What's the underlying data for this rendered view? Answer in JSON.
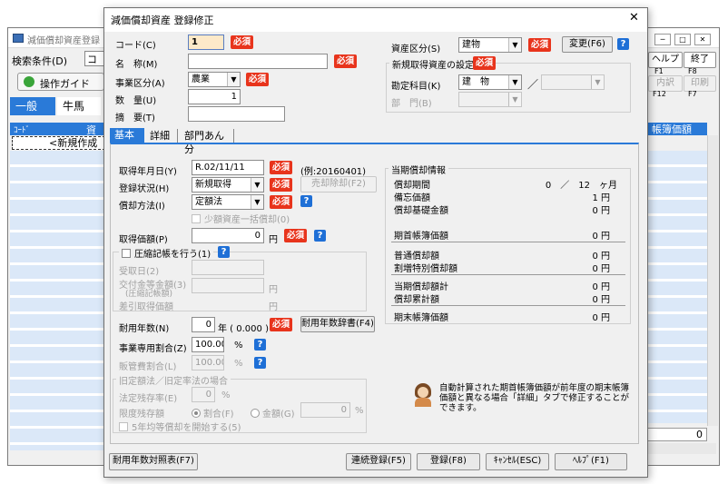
{
  "bg": {
    "title": "減価償却資産登録",
    "search_label": "検索条件(D)",
    "search_cut": "コ",
    "guide_btn": "操作ガイド",
    "tab_general": "一般",
    "tab_horse": "牛馬",
    "col_code": "ｺｰﾄﾞ",
    "col_asset": "資",
    "col_book": "帳簿価額",
    "new_row": "<新規作成",
    "help_btn": "ヘルプ",
    "end_btn": "終了",
    "f1": "F1",
    "f8": "F8",
    "detail_btn": "内訳",
    "print_btn": "印刷",
    "f12": "F12",
    "f7": "F7",
    "total": "0"
  },
  "dlg": {
    "title": "減価償却資産 登録修正",
    "close": "✕",
    "required": "必須",
    "code_label": "コード(C)",
    "code_value": "1",
    "name_label": "名　称(M)",
    "name_value": "",
    "biz_label": "事業区分(A)",
    "biz_value": "農業",
    "qty_label": "数　量(U)",
    "qty_value": "1",
    "memo_label": "摘　要(T)",
    "asset_cat_label": "資産区分(S)",
    "asset_cat_value": "建物",
    "change_btn": "変更(F6)",
    "new_setting_title": "新規取得資産の設定",
    "account_label": "勘定科目(K)",
    "account_value": "建　物",
    "slash": "／",
    "dept_label": "部　門(B)"
  },
  "tabs": [
    "基本",
    "詳細",
    "部門あん分"
  ],
  "basic": {
    "acq_date_label": "取得年月日(Y)",
    "acq_date_value": "R.02/11/11",
    "acq_date_example": "(例:20160401)",
    "reg_status_label": "登録状況(H)",
    "reg_status_value": "新規取得",
    "sale_btn": "売却除却(F2)",
    "method_label": "償却方法(I)",
    "method_value": "定額法",
    "small_asset": "少額資産一括償却(0)",
    "acq_price_label": "取得価額(P)",
    "acq_price_value": "0",
    "yen": "円",
    "compress_title": "圧縮記帳を行う(1)",
    "received_date": "受取日(2)",
    "subsidy_label1": "交付金等金額(3)",
    "subsidy_label2": "(圧縮記帳額)",
    "deduct_price": "差引取得価額",
    "life_label": "耐用年数(N)",
    "life_value": "0",
    "life_unit": "年 ( 0.000 )",
    "life_dict_btn": "耐用年数辞書(F4)",
    "biz_ratio_label": "事業専用割合(Z)",
    "biz_ratio_value": "100.00",
    "sell_ratio_label": "販管費割合(L)",
    "sell_ratio_value": "100.00",
    "percent": "%",
    "old_method_title": "旧定額法／旧定率法の場合",
    "residual_rate_label": "法定残存率(E)",
    "residual_rate_value": "0",
    "limit_label": "限度残存額",
    "ratio_radio": "割合(F)",
    "amount_radio": "金額(G)",
    "limit_amount_value": "0",
    "five_year": "5年均等償却を開始する(5)"
  },
  "period": {
    "title": "当期償却情報",
    "dep_period_label": "償却期間",
    "dep_period_value": "0　／　12　ヶ月",
    "memo_value_label": "備忘価額",
    "memo_value": "1 円",
    "base_label": "償却基礎金額",
    "base_value": "0 円",
    "opening_label": "期首帳簿価額",
    "opening_value": "0 円",
    "normal_label": "普通償却額",
    "normal_value": "0 円",
    "special_label": "割増特別償却額",
    "special_value": "0 円",
    "current_label": "当期償却額計",
    "current_value": "0 円",
    "cumulative_label": "償却累計額",
    "cumulative_value": "0 円",
    "closing_label": "期末帳簿価額",
    "closing_value": "0 円"
  },
  "notice": "自動計算された期首帳簿価額が前年度の期末帳簿価額と異なる場合「詳細」タブで修正することができます。",
  "footer": {
    "life_table_btn": "耐用年数対照表(F7)",
    "continuous_btn": "連続登録(F5)",
    "register_btn": "登録(F8)",
    "cancel_btn": "ｷｬﾝｾﾙ(ESC)",
    "help_btn": "ﾍﾙﾌﾟ(F1)"
  },
  "colors": {
    "required": "#e8341c",
    "help": "#1e6fd6",
    "tab_active": "#2a7ad8",
    "dialog_bg": "#f0f0f0"
  }
}
